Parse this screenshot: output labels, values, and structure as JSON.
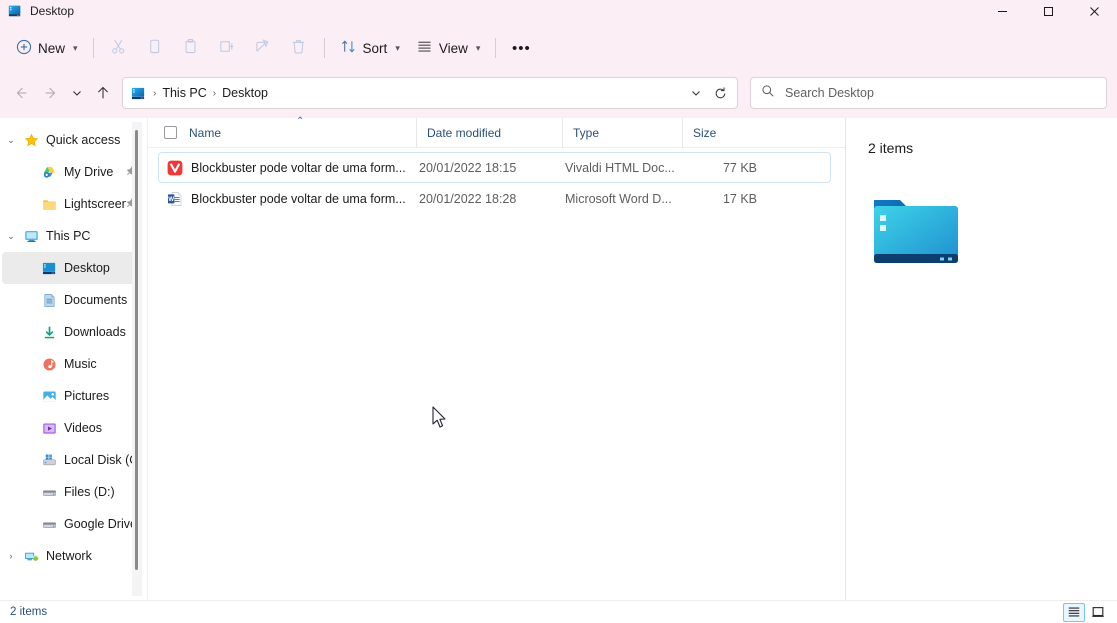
{
  "window": {
    "title": "Desktop",
    "app_icon": "desktop-icon",
    "controls": {
      "minimize": "—",
      "maximize": "☐",
      "close": "✕"
    }
  },
  "toolbar": {
    "new_label": "New",
    "new_icon": "plus-circle-icon",
    "cut_icon": "scissors-icon",
    "copy_icon": "copy-icon",
    "paste_icon": "paste-icon",
    "rename_icon": "rename-icon",
    "share_icon": "share-icon",
    "delete_icon": "trash-icon",
    "sort_label": "Sort",
    "sort_icon": "sort-arrows-icon",
    "view_label": "View",
    "view_icon": "view-lines-icon",
    "more_label": "•••"
  },
  "address": {
    "back_icon": "arrow-left-icon",
    "forward_icon": "arrow-right-icon",
    "recent_icon": "chevron-down-icon",
    "up_icon": "arrow-up-icon",
    "path_icon": "desktop-icon",
    "crumbs": [
      "This PC",
      "Desktop"
    ],
    "separator": "›",
    "dropdown_icon": "chevron-down-icon",
    "refresh_icon": "refresh-icon"
  },
  "search": {
    "icon": "search-icon",
    "placeholder": "Search Desktop",
    "value": ""
  },
  "sidebar": {
    "items": [
      {
        "label": "Quick access",
        "icon": "star-icon",
        "level": 1,
        "expanded": true,
        "twisty": "⌄",
        "pinned": false,
        "selected": false
      },
      {
        "label": "My Drive",
        "icon": "google-drive-icon",
        "level": 2,
        "twisty": "",
        "pinned": true,
        "selected": false
      },
      {
        "label": "Lightscreen",
        "icon": "folder-icon",
        "level": 2,
        "twisty": "",
        "pinned": true,
        "selected": false
      },
      {
        "label": "This PC",
        "icon": "this-pc-icon",
        "level": 1,
        "expanded": true,
        "twisty": "⌄",
        "pinned": false,
        "selected": false
      },
      {
        "label": "Desktop",
        "icon": "desktop-icon",
        "level": 2,
        "twisty": "›",
        "pinned": false,
        "selected": true
      },
      {
        "label": "Documents",
        "icon": "documents-icon",
        "level": 2,
        "twisty": "›",
        "pinned": false,
        "selected": false
      },
      {
        "label": "Downloads",
        "icon": "downloads-icon",
        "level": 2,
        "twisty": "›",
        "pinned": false,
        "selected": false
      },
      {
        "label": "Music",
        "icon": "music-icon",
        "level": 2,
        "twisty": "›",
        "pinned": false,
        "selected": false
      },
      {
        "label": "Pictures",
        "icon": "pictures-icon",
        "level": 2,
        "twisty": "›",
        "pinned": false,
        "selected": false
      },
      {
        "label": "Videos",
        "icon": "videos-icon",
        "level": 2,
        "twisty": "›",
        "pinned": false,
        "selected": false
      },
      {
        "label": "Local Disk (C:)",
        "icon": "system-drive-icon",
        "level": 2,
        "twisty": "›",
        "pinned": false,
        "selected": false
      },
      {
        "label": "Files (D:)",
        "icon": "drive-icon",
        "level": 2,
        "twisty": "›",
        "pinned": false,
        "selected": false
      },
      {
        "label": "Google Drive (G",
        "icon": "drive-icon",
        "level": 2,
        "twisty": "›",
        "pinned": false,
        "selected": false
      },
      {
        "label": "Network",
        "icon": "network-icon",
        "level": 1,
        "twisty": "›",
        "pinned": false,
        "selected": false
      }
    ]
  },
  "filelist": {
    "columns": {
      "name": "Name",
      "date_modified": "Date modified",
      "type": "Type",
      "size": "Size"
    },
    "sort_indicator": "⌃",
    "rows": [
      {
        "name": "Blockbuster pode voltar de uma form...",
        "date_modified": "20/01/2022 18:15",
        "type": "Vivaldi HTML Doc...",
        "size": "77 KB",
        "icon": "vivaldi-icon",
        "focused": true
      },
      {
        "name": "Blockbuster pode voltar de uma form...",
        "date_modified": "20/01/2022 18:28",
        "type": "Microsoft Word D...",
        "size": "17 KB",
        "icon": "word-icon",
        "focused": false
      }
    ]
  },
  "details_pane": {
    "count_label": "2 items",
    "folder_icon": "desktop-folder-large-icon"
  },
  "statusbar": {
    "count_label": "2 items",
    "details_view_icon": "details-view-icon",
    "large_icons_view_icon": "large-icons-view-icon",
    "active_view": "details"
  },
  "colors": {
    "titlebar_bg": "#fbeef4",
    "accent": "#0067c0",
    "selection_border": "#cfe4f7",
    "header_text": "#2b4f7a"
  }
}
